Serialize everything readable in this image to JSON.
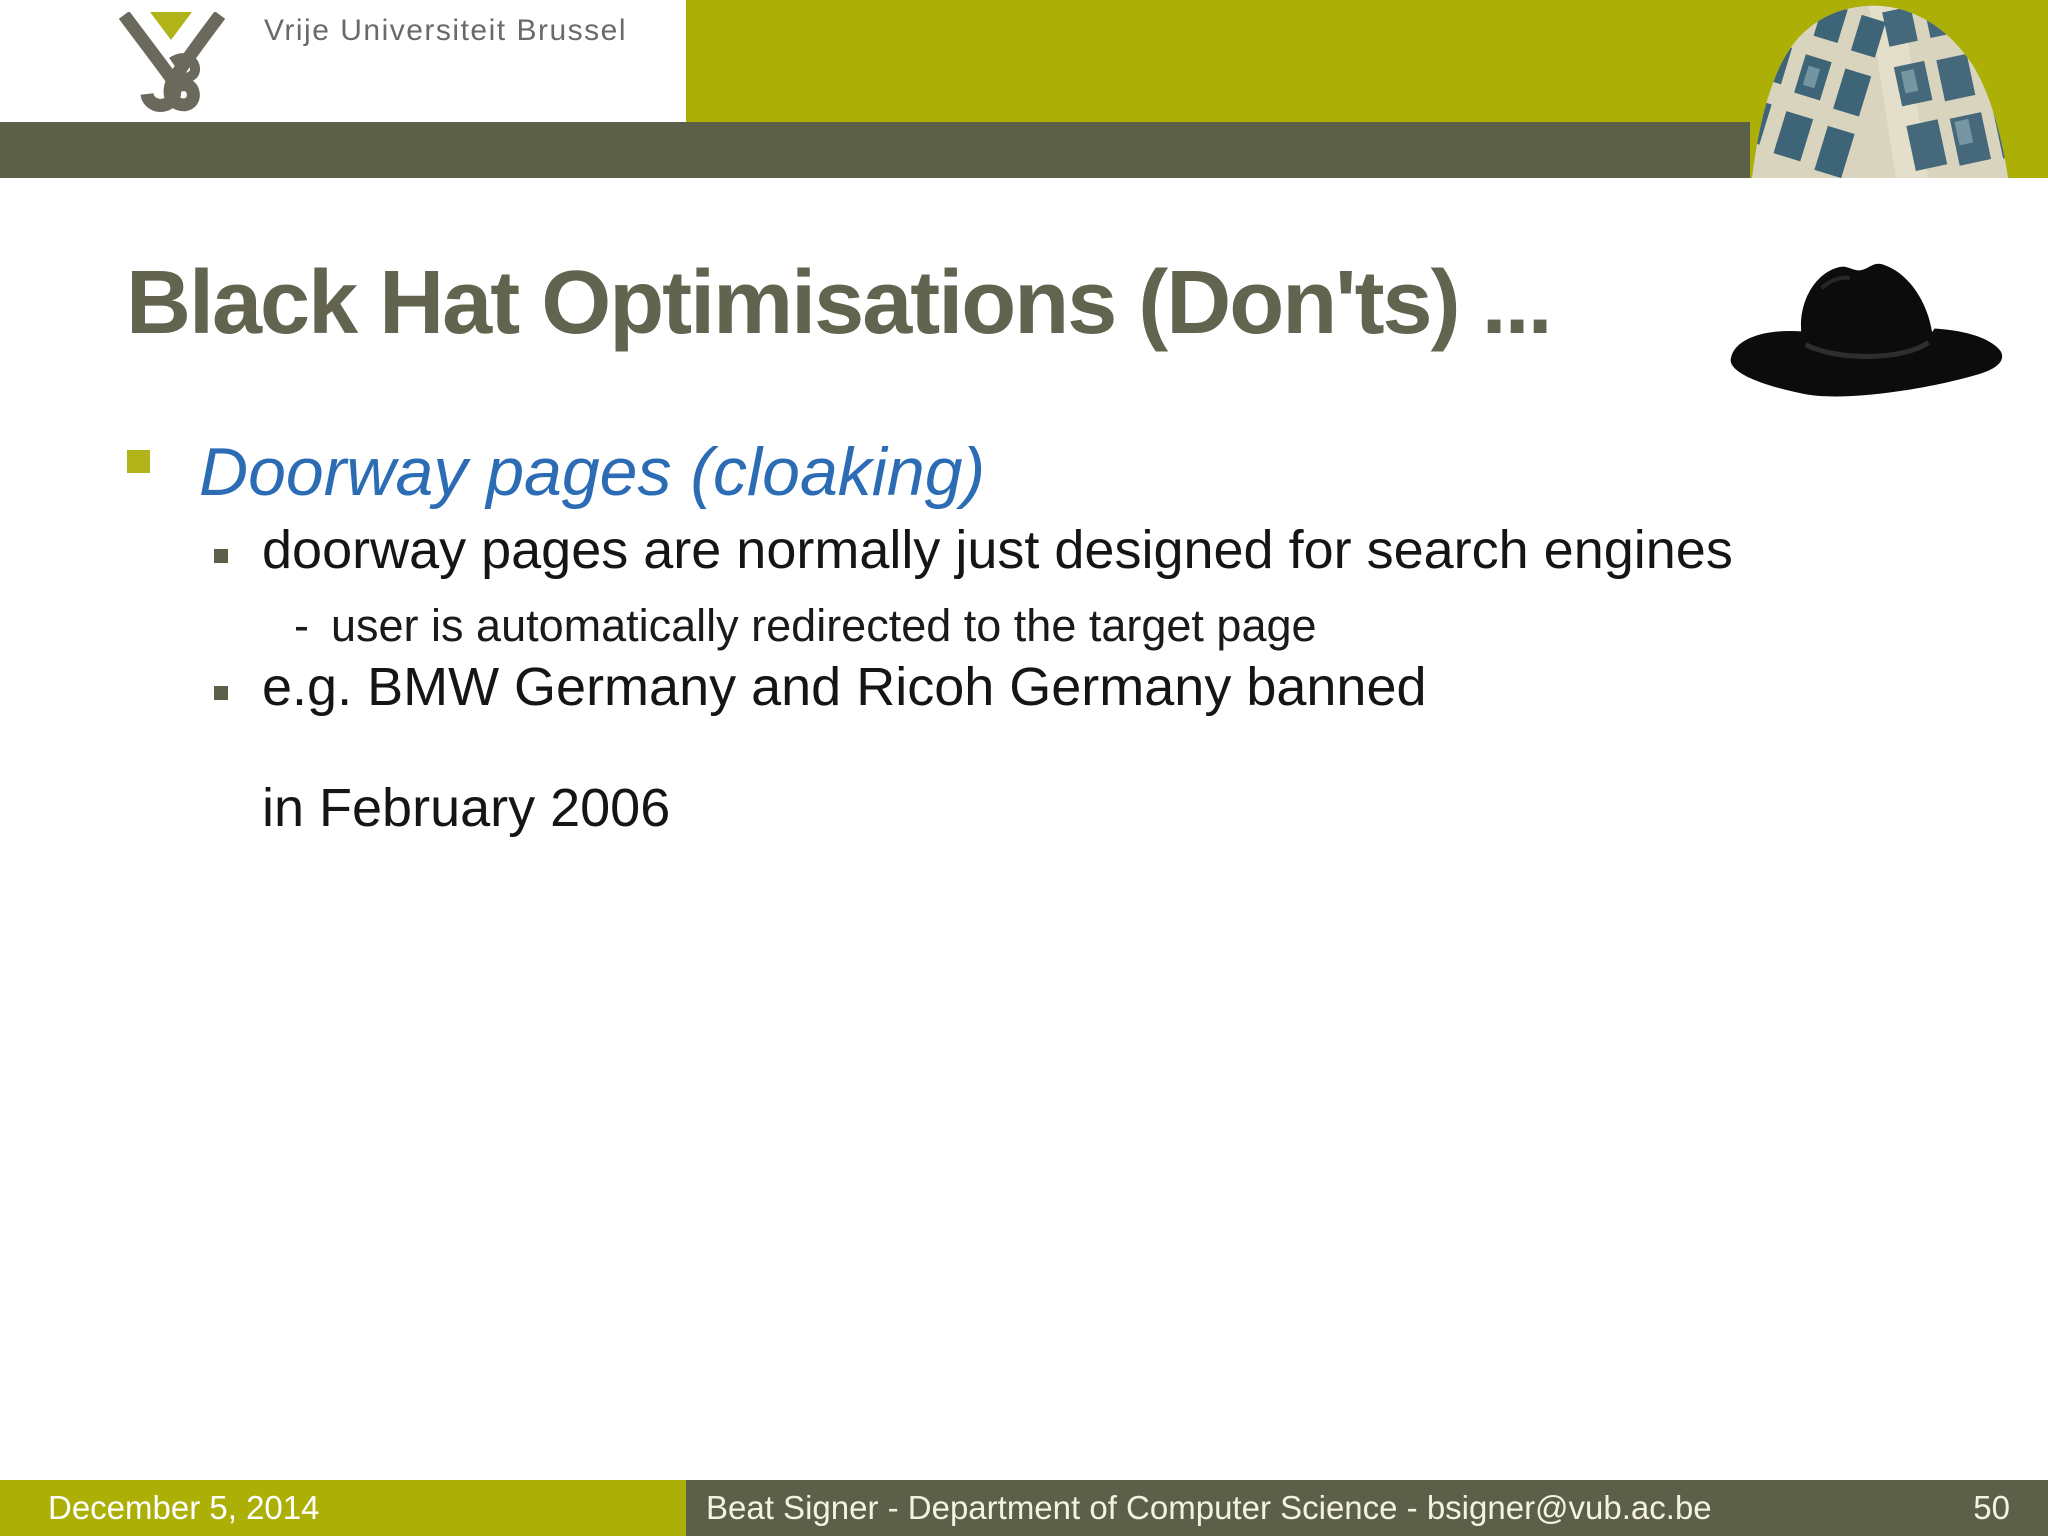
{
  "header": {
    "university_name": "Vrije Universiteit Brussel",
    "logo_icon": "vub-v-monogram-with-yellow-triangle",
    "photo_icon": "campus-building-photo"
  },
  "title": "Black Hat Optimisations (Don'ts) ...",
  "title_icon": "black-cowboy-hat",
  "bullets": {
    "level1": "Doorway pages (cloaking)",
    "level2_first": "doorway pages are normally just designed for search engines",
    "level3_marker": "-",
    "level3": "user is automatically redirected to the target page",
    "level2_second_line1": "e.g. BMW Germany and Ricoh Germany banned",
    "level2_second_line2": "in February 2006"
  },
  "footer": {
    "date": "December 5, 2014",
    "credit": "Beat Signer - Department of Computer Science - bsigner@vub.ac.be",
    "page": "50"
  },
  "colors": {
    "accent_yellow_green": "#ABAF06",
    "dark_olive": "#5C6048",
    "title_olive": "#636450",
    "bullet_yellow": "#B1B418",
    "blue_heading": "#2B6CB5",
    "footer_cream": "#F4F2E2"
  }
}
